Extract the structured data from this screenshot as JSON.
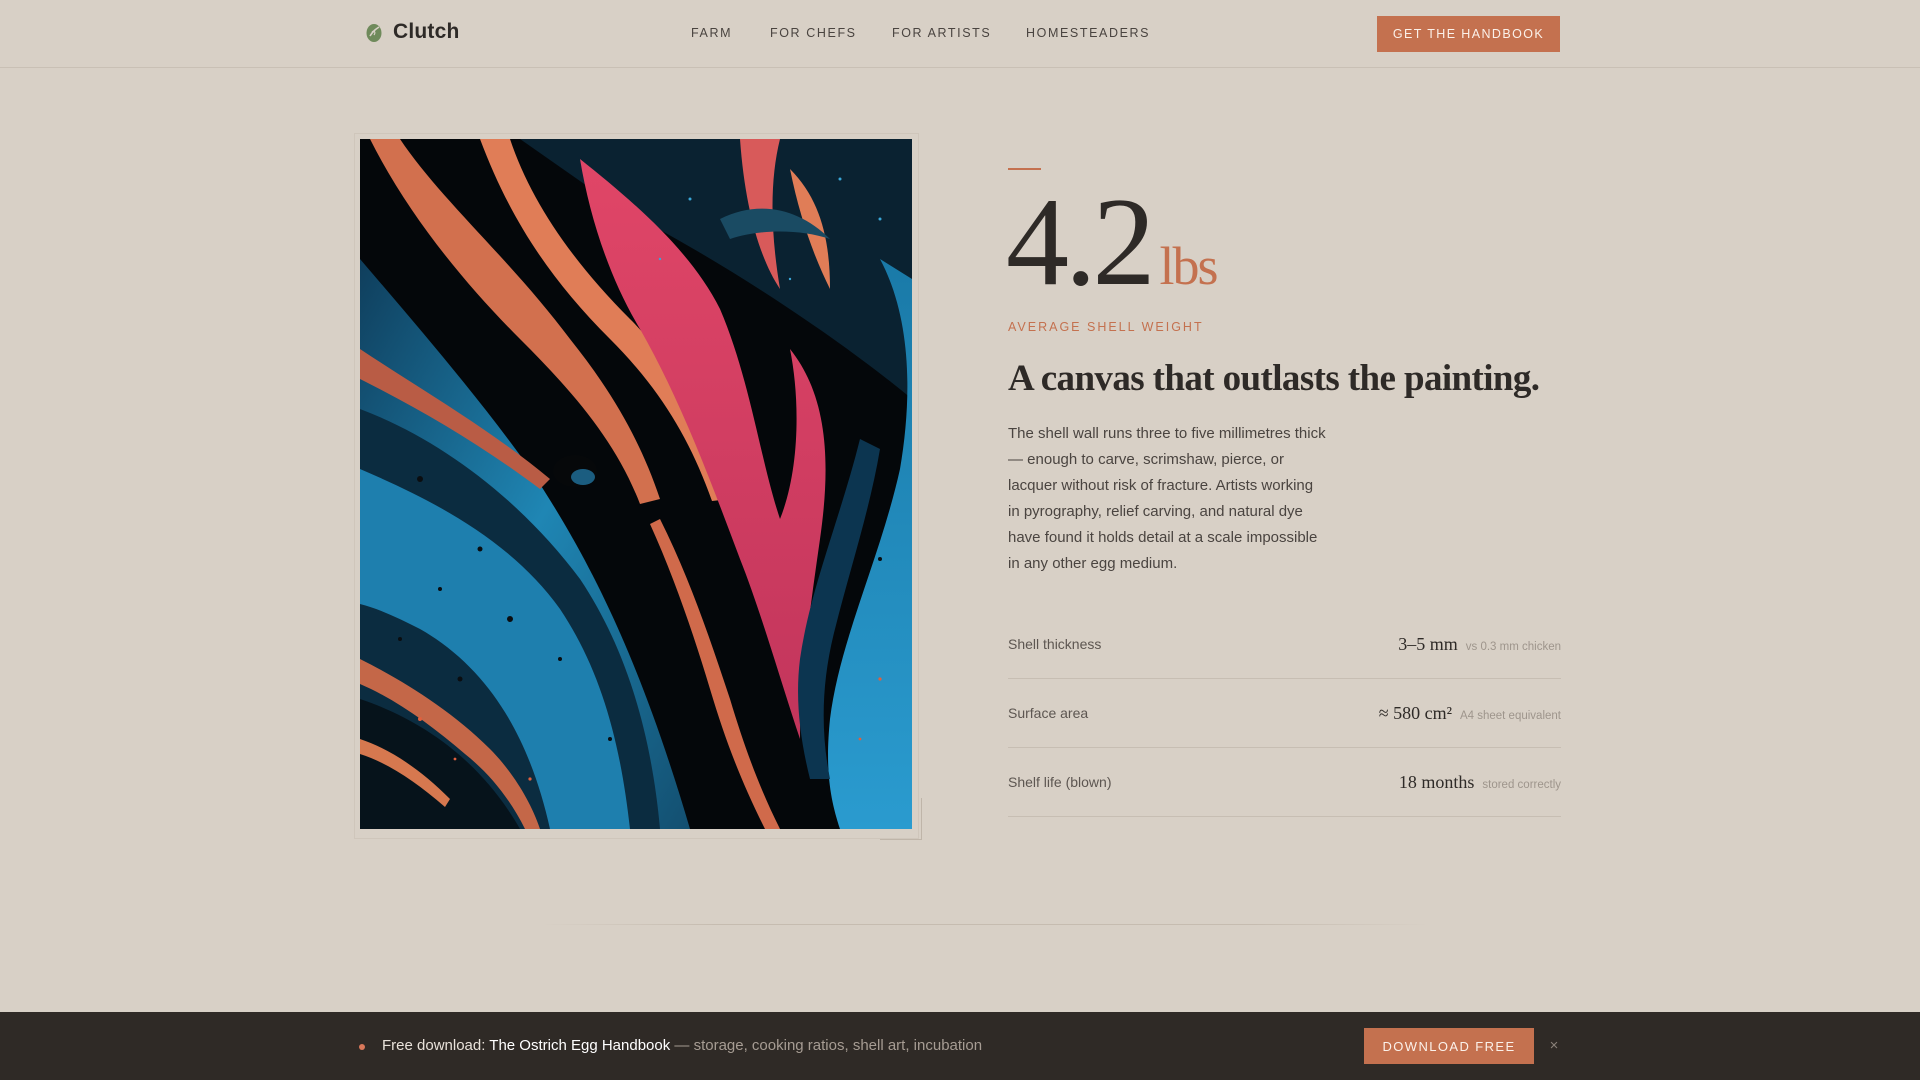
{
  "header": {
    "logo_text": "Clutch",
    "logo_icon": "egg-leaf-icon",
    "nav": [
      {
        "label": "FARM"
      },
      {
        "label": "FOR CHEFS"
      },
      {
        "label": "FOR ARTISTS"
      },
      {
        "label": "HOMESTEADERS"
      }
    ],
    "cta_label": "GET THE HANDBOOK"
  },
  "artwork": {
    "description_icon": "abstract-fluid-art-image"
  },
  "feature": {
    "stat_value": "4.2",
    "stat_unit": "lbs",
    "stat_label": "AVERAGE SHELL WEIGHT",
    "headline": "A canvas that outlasts the painting.",
    "body": "The shell wall runs three to five millimetres thick — enough to carve, scrimshaw, pierce, or lacquer without risk of fracture. Artists working in pyrography, relief carving, and natural dye have found it holds detail at a scale impossible in any other egg medium.",
    "specs": [
      {
        "label": "Shell thickness",
        "value": "3–5 mm",
        "note": "vs 0.3 mm chicken"
      },
      {
        "label": "Surface area",
        "value": "≈ 580 cm²",
        "note": "A4 sheet equivalent"
      },
      {
        "label": "Shelf life (blown)",
        "value": "18 months",
        "note": "stored correctly"
      }
    ]
  },
  "banner": {
    "lead": "Free download: ",
    "book": "The Ostrich Egg Handbook",
    "rest": " — storage, cooking ratios, shell art, incubation",
    "button_label": "DOWNLOAD FREE",
    "close_symbol": "×"
  },
  "colors": {
    "background": "#d8d0c6",
    "accent": "#c4714f",
    "text": "#2e2a27",
    "bar": "#2f2a26"
  }
}
